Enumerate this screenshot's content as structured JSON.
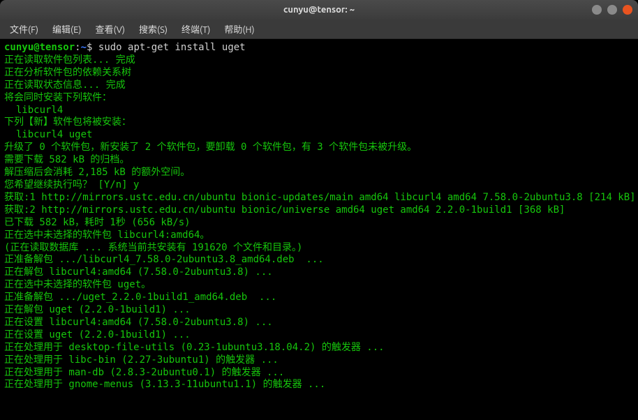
{
  "titlebar": {
    "title": "cunyu@tensor: ~"
  },
  "menubar": {
    "items": [
      {
        "label": "文件(F)"
      },
      {
        "label": "编辑(E)"
      },
      {
        "label": "查看(V)"
      },
      {
        "label": "搜索(S)"
      },
      {
        "label": "终端(T)"
      },
      {
        "label": "帮助(H)"
      }
    ]
  },
  "prompt": {
    "userhost": "cunyu@tensor",
    "sep": ":",
    "path": "~",
    "dollar": "$ ",
    "command": "sudo apt-get install uget"
  },
  "output": [
    "正在读取软件包列表... 完成",
    "正在分析软件包的依赖关系树       ",
    "正在读取状态信息... 完成       ",
    "将会同时安装下列软件：",
    "  libcurl4",
    "下列【新】软件包将被安装：",
    "  libcurl4 uget",
    "升级了 0 个软件包，新安装了 2 个软件包，要卸载 0 个软件包，有 3 个软件包未被升级。",
    "需要下载 582 kB 的归档。",
    "解压缩后会消耗 2,185 kB 的额外空间。",
    "您希望继续执行吗？ [Y/n] y",
    "获取:1 http://mirrors.ustc.edu.cn/ubuntu bionic-updates/main amd64 libcurl4 amd64 7.58.0-2ubuntu3.8 [214 kB]",
    "获取:2 http://mirrors.ustc.edu.cn/ubuntu bionic/universe amd64 uget amd64 2.2.0-1build1 [368 kB]",
    "已下载 582 kB，耗时 1秒 (656 kB/s)",
    "正在选中未选择的软件包 libcurl4:amd64。",
    "(正在读取数据库 ... 系统当前共安装有 191620 个文件和目录。)",
    "正准备解包 .../libcurl4_7.58.0-2ubuntu3.8_amd64.deb  ...",
    "正在解包 libcurl4:amd64 (7.58.0-2ubuntu3.8) ...",
    "正在选中未选择的软件包 uget。",
    "正准备解包 .../uget_2.2.0-1build1_amd64.deb  ...",
    "正在解包 uget (2.2.0-1build1) ...",
    "正在设置 libcurl4:amd64 (7.58.0-2ubuntu3.8) ...",
    "正在设置 uget (2.2.0-1build1) ...",
    "正在处理用于 desktop-file-utils (0.23-1ubuntu3.18.04.2) 的触发器 ...",
    "正在处理用于 libc-bin (2.27-3ubuntu1) 的触发器 ...",
    "正在处理用于 man-db (2.8.3-2ubuntu0.1) 的触发器 ...",
    "正在处理用于 gnome-menus (3.13.3-11ubuntu1.1) 的触发器 ..."
  ]
}
